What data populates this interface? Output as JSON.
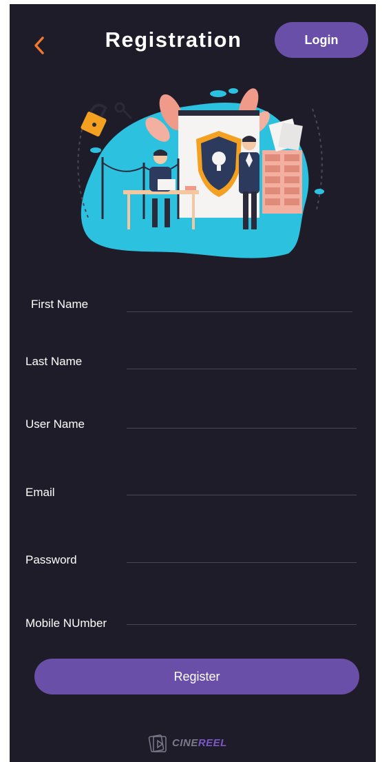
{
  "header": {
    "title": "Registration",
    "login_label": "Login"
  },
  "form": {
    "fields": [
      {
        "label": "First Name",
        "value": ""
      },
      {
        "label": "Last Name",
        "value": ""
      },
      {
        "label": "User Name",
        "value": ""
      },
      {
        "label": "Email",
        "value": ""
      },
      {
        "label": "Password",
        "value": ""
      },
      {
        "label": "Mobile NUmber",
        "value": ""
      }
    ],
    "register_label": "Register"
  },
  "brand": {
    "part1": "CINE",
    "part2": "REEL"
  },
  "colors": {
    "background": "#1e1c28",
    "accent": "#6a4fa8",
    "back_arrow": "#f07830"
  },
  "icons": {
    "back": "chevron-left-icon",
    "brand": "film-reel-icon"
  }
}
